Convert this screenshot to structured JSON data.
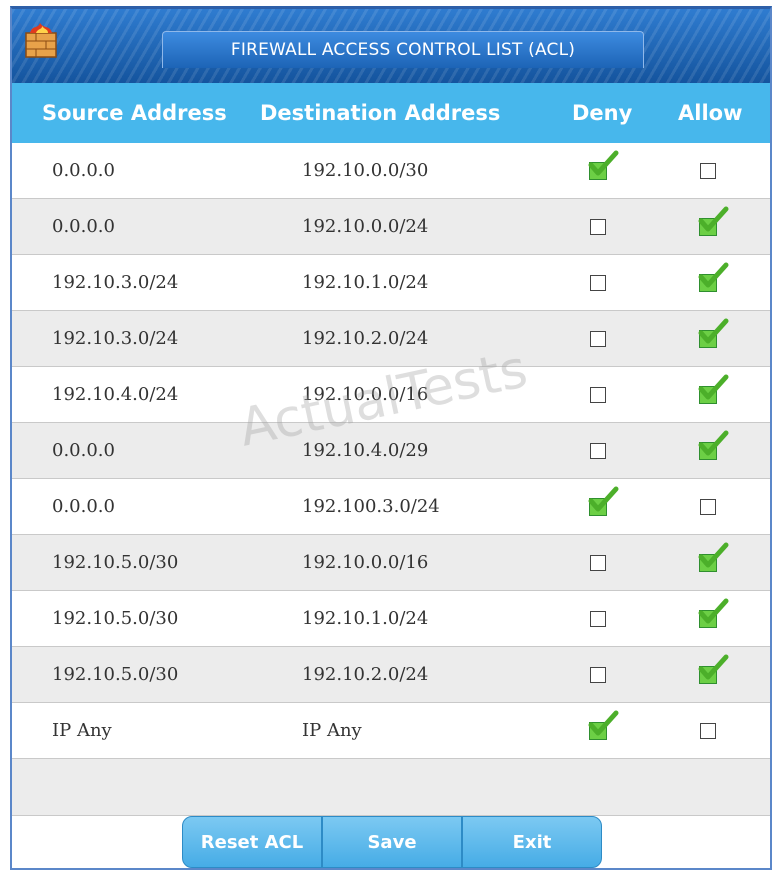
{
  "window": {
    "title": "FIREWALL ACCESS CONTROL LIST (ACL)"
  },
  "columns": {
    "source": "Source Address",
    "destination": "Destination Address",
    "deny": "Deny",
    "allow": "Allow"
  },
  "rules": [
    {
      "source": "0.0.0.0",
      "destination": "192.10.0.0/30",
      "deny": true,
      "allow": false
    },
    {
      "source": "0.0.0.0",
      "destination": "192.10.0.0/24",
      "deny": false,
      "allow": true
    },
    {
      "source": "192.10.3.0/24",
      "destination": "192.10.1.0/24",
      "deny": false,
      "allow": true
    },
    {
      "source": "192.10.3.0/24",
      "destination": "192.10.2.0/24",
      "deny": false,
      "allow": true
    },
    {
      "source": "192.10.4.0/24",
      "destination": "192.10.0.0/16",
      "deny": false,
      "allow": true
    },
    {
      "source": "0.0.0.0",
      "destination": "192.10.4.0/29",
      "deny": false,
      "allow": true
    },
    {
      "source": "0.0.0.0",
      "destination": "192.100.3.0/24",
      "deny": true,
      "allow": false
    },
    {
      "source": "192.10.5.0/30",
      "destination": "192.10.0.0/16",
      "deny": false,
      "allow": true
    },
    {
      "source": "192.10.5.0/30",
      "destination": "192.10.1.0/24",
      "deny": false,
      "allow": true
    },
    {
      "source": "192.10.5.0/30",
      "destination": "192.10.2.0/24",
      "deny": false,
      "allow": true
    },
    {
      "source": "IP Any",
      "destination": "IP Any",
      "deny": true,
      "allow": false
    }
  ],
  "buttons": {
    "reset": "Reset ACL",
    "save": "Save",
    "exit": "Exit"
  },
  "watermark": "ActualTests",
  "colors": {
    "header_bg": "#47b7ec",
    "titlebar_bg": "#1e64b4",
    "check_green": "#4caf2a",
    "button_bg": "#46ace6"
  },
  "icons": {
    "app": "firewall-icon",
    "check": "green-checkmark-icon"
  }
}
